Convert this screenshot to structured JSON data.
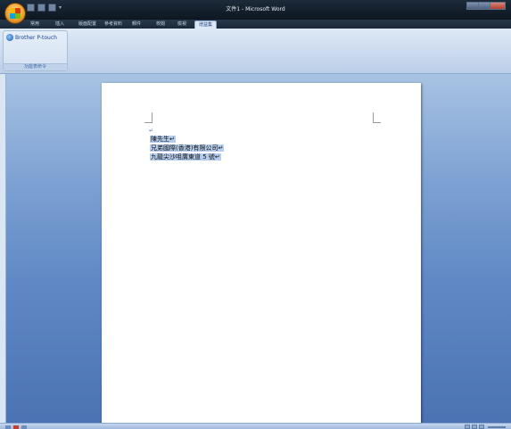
{
  "window": {
    "title": "文件1 - Microsoft Word"
  },
  "quick_access": {
    "dropdown": "▾"
  },
  "tabs": [
    {
      "label": "常用",
      "active": false
    },
    {
      "label": "插入",
      "active": false
    },
    {
      "label": "版面配置",
      "active": false
    },
    {
      "label": "參考資料",
      "active": false
    },
    {
      "label": "郵件",
      "active": false
    },
    {
      "label": "校閱",
      "active": false
    },
    {
      "label": "檢視",
      "active": false
    },
    {
      "label": "增益集",
      "active": true
    }
  ],
  "ribbon": {
    "group": {
      "command_label": "Brother P-touch",
      "group_label": "功能表命令"
    }
  },
  "document": {
    "paragraph_mark": "↵",
    "lines": [
      "陳先生↵",
      "兄弟國際(香港)有限公司↵",
      "九龍尖沙咀廣東道 5 號↵"
    ]
  },
  "statusbar": {}
}
